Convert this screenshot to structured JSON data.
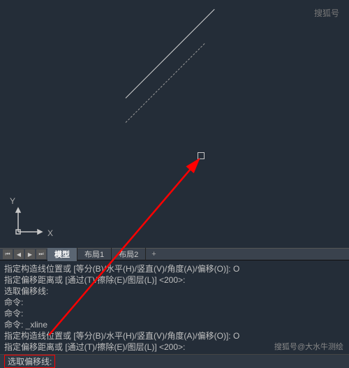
{
  "ucs": {
    "x_label": "X",
    "y_label": "Y"
  },
  "tabs": {
    "model": "模型",
    "layout1": "布局1",
    "layout2": "布局2",
    "add": "+"
  },
  "history": {
    "l1": "指定构造线位置或  [等分(B)/水平(H)/竖直(V)/角度(A)/偏移(O)]: O",
    "l2": "指定偏移距离或 [通过(T)/擦除(E)/图层(L)] <200>:",
    "l3": "选取偏移线:",
    "l4": "命令:",
    "l5": "命令:",
    "l6": "命令: _xline",
    "l7": "指定构造线位置或  [等分(B)/水平(H)/竖直(V)/角度(A)/偏移(O)]: O",
    "l8": "指定偏移距离或 [通过(T)/擦除(E)/图层(L)] <200>:"
  },
  "prompt": "选取偏移线:",
  "watermark_tr": "搜狐号",
  "watermark_br": "搜狐号@大水牛测绘"
}
